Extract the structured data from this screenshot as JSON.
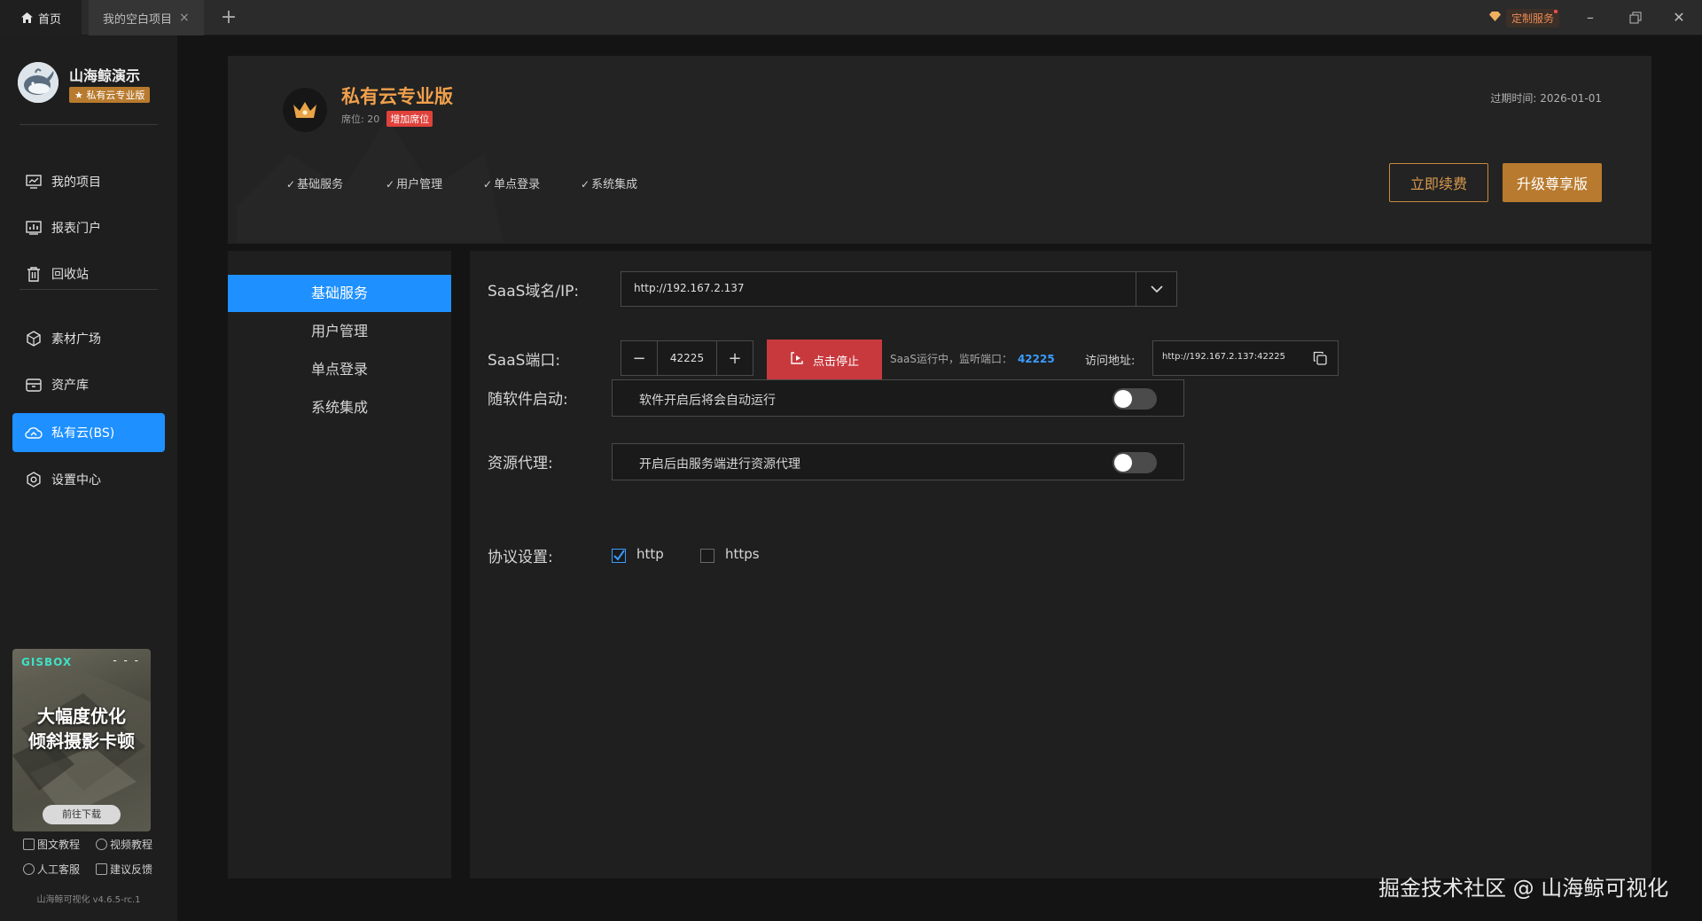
{
  "titlebar": {
    "home_tab": "首页",
    "project_tab": "我的空白项目",
    "custom_service": "定制服务"
  },
  "sidebar": {
    "user_name": "山海鲸演示",
    "edition_badge": "★ 私有云专业版",
    "items": [
      {
        "label": "我的项目",
        "icon": "chart-icon"
      },
      {
        "label": "报表门户",
        "icon": "report-icon"
      },
      {
        "label": "回收站",
        "icon": "trash-icon"
      },
      {
        "label": "素材广场",
        "icon": "cube-icon"
      },
      {
        "label": "资产库",
        "icon": "asset-icon"
      },
      {
        "label": "私有云(BS)",
        "icon": "cloud-icon",
        "active": true
      },
      {
        "label": "设置中心",
        "icon": "gear-icon"
      }
    ],
    "ad": {
      "logo": "GISBOX",
      "line1": "大幅度优化",
      "line2": "倾斜摄影卡顿",
      "button": "前往下载"
    },
    "help": {
      "doc": "图文教程",
      "video": "视频教程",
      "support": "人工客服",
      "feedback": "建议反馈"
    },
    "version": "山海鲸可视化 v4.6.5-rc.1"
  },
  "header": {
    "plan_title": "私有云专业版",
    "seats": "席位: 20",
    "add_seats": "增加席位",
    "expiry": "过期时间: 2026-01-01",
    "features": [
      "基础服务",
      "用户管理",
      "单点登录",
      "系统集成"
    ],
    "renew": "立即续费",
    "upgrade": "升级尊享版"
  },
  "subnav": {
    "items": [
      "基础服务",
      "用户管理",
      "单点登录",
      "系统集成"
    ],
    "active_index": 0
  },
  "form": {
    "domain_label": "SaaS域名/IP:",
    "domain_value": "http://192.167.2.137",
    "port_label": "SaaS端口:",
    "port_value": "42225",
    "stop_button": "点击停止",
    "status_text": "SaaS运行中，监听端口：",
    "status_port": "42225",
    "access_label": "访问地址:",
    "access_value": "http://192.167.2.137:42225",
    "autostart_label": "随软件启动:",
    "autostart_desc": "软件开启后将会自动运行",
    "autostart_on": false,
    "proxy_label": "资源代理:",
    "proxy_desc": "开启后由服务端进行资源代理",
    "proxy_on": false,
    "protocol_label": "协议设置:",
    "protocols": [
      {
        "name": "http",
        "checked": true
      },
      {
        "name": "https",
        "checked": false
      }
    ]
  },
  "watermark": "掘金技术社区 @ 山海鲸可视化",
  "colors": {
    "accent": "#1e90ff",
    "gold": "#b87a2e",
    "danger": "#c8393e"
  }
}
